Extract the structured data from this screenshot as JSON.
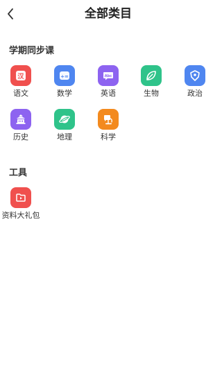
{
  "header": {
    "title": "全部类目"
  },
  "sections": [
    {
      "title": "学期同步课",
      "items": [
        {
          "label": "语文",
          "icon": "chinese-icon",
          "color": "#F0504E"
        },
        {
          "label": "数学",
          "icon": "math-icon",
          "color": "#4F86F0"
        },
        {
          "label": "英语",
          "icon": "english-icon",
          "color": "#8D63F0"
        },
        {
          "label": "生物",
          "icon": "biology-icon",
          "color": "#2FC38A"
        },
        {
          "label": "政治",
          "icon": "politics-icon",
          "color": "#4F86F0"
        },
        {
          "label": "历史",
          "icon": "history-icon",
          "color": "#8D63F0"
        },
        {
          "label": "地理",
          "icon": "geography-icon",
          "color": "#2FC38A"
        },
        {
          "label": "科学",
          "icon": "science-icon",
          "color": "#F38A1E"
        }
      ]
    },
    {
      "title": "工具",
      "items": [
        {
          "label": "资料大礼包",
          "icon": "video-folder-icon",
          "color": "#F0504E"
        }
      ]
    }
  ],
  "icon_text": {
    "chinese": "汉",
    "math": "+=",
    "english": "Abc"
  }
}
